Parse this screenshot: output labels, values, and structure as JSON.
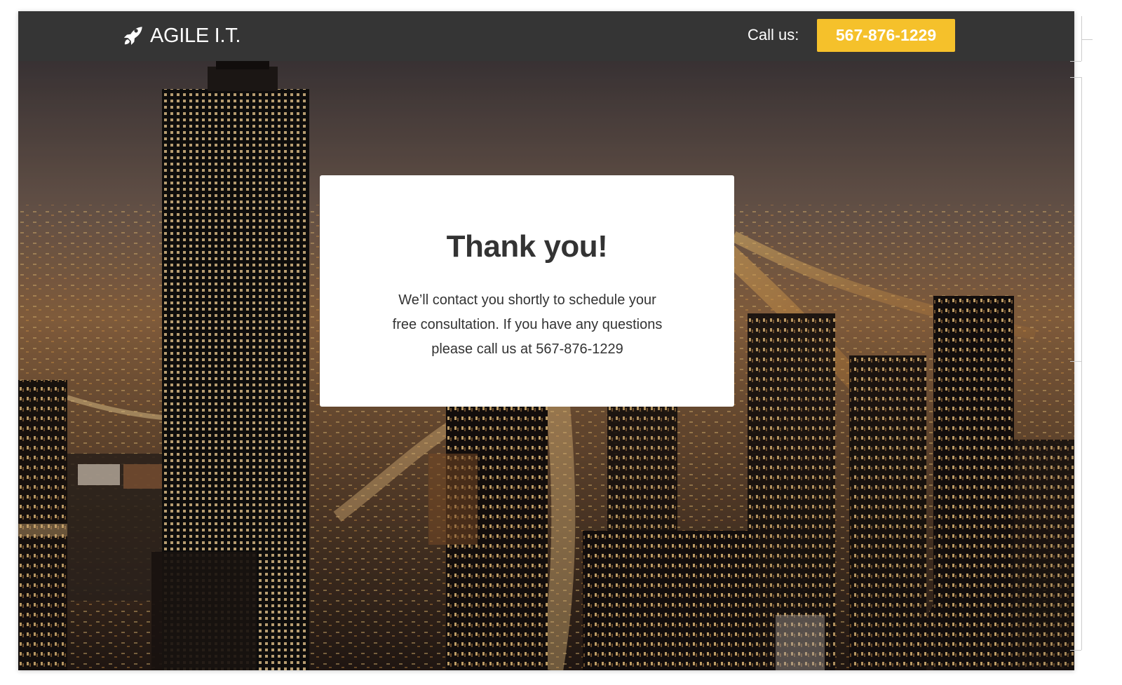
{
  "header": {
    "brand": "AGILE I.T.",
    "brand_icon": "rocket-icon",
    "call_label": "Call us:",
    "phone": "567-876-1229"
  },
  "modal": {
    "title": "Thank you!",
    "body_lines": [
      "We’ll contact you shortly to schedule your",
      "free consultation. If you have any questions",
      "please call us at 567-876-1229"
    ]
  },
  "colors": {
    "header_background": "#353535",
    "accent": "#f5c12b",
    "modal_background": "#ffffff",
    "text": "#333333"
  }
}
